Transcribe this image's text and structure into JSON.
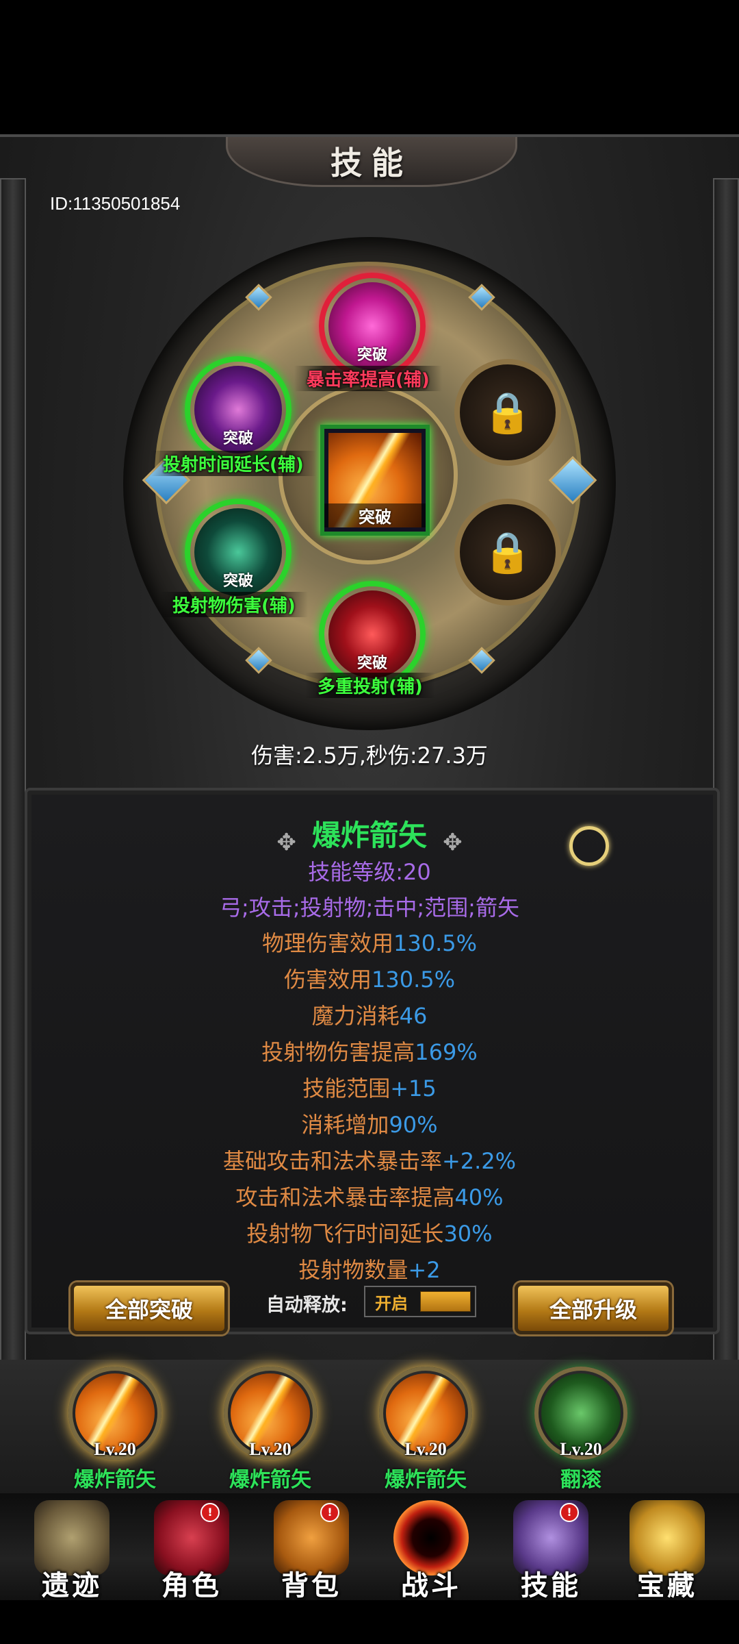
{
  "header": {
    "title": "技能",
    "user_id": "ID:11350501854"
  },
  "wheel": {
    "center_skill": {
      "badge": "突破",
      "icon": "explosive-arrow-icon"
    },
    "break_label": "突破",
    "support_skills": [
      {
        "name": "暴击率提高(辅)",
        "badge": "突破",
        "state": "red"
      },
      {
        "name": "投射时间延长(辅)",
        "badge": "突破",
        "state": "green"
      },
      {
        "name": "投射物伤害(辅)",
        "badge": "突破",
        "state": "green"
      },
      {
        "name": "多重投射(辅)",
        "badge": "突破",
        "state": "green"
      }
    ],
    "locked_slots": 2
  },
  "damage_line": "伤害:2.5万,秒伤:27.3万",
  "skill_info": {
    "name": "爆炸箭矢",
    "level_label": "技能等级:20",
    "tags": "弓;攻击;投射物;击中;范围;箭矢",
    "stats": [
      {
        "label": "物理伤害效用",
        "value": "130.5%"
      },
      {
        "label": "伤害效用",
        "value": "130.5%"
      },
      {
        "label": "魔力消耗",
        "value": "46"
      },
      {
        "label": "投射物伤害提高",
        "value": "169%"
      },
      {
        "label": "技能范围",
        "value": "+15"
      },
      {
        "label": "消耗增加",
        "value": "90%"
      },
      {
        "label": "基础攻击和法术暴击率",
        "value": "+2.2%"
      },
      {
        "label": "攻击和法术暴击率提高",
        "value": "40%"
      },
      {
        "label": "投射物飞行时间延长",
        "value": "30%"
      },
      {
        "label": "投射物数量",
        "value": "+2"
      }
    ]
  },
  "actions": {
    "break_all": "全部突破",
    "auto_release_label": "自动释放:",
    "auto_release_state": "开启",
    "upgrade_all": "全部升级"
  },
  "equipped": [
    {
      "level": "Lv.20",
      "name": "爆炸箭矢"
    },
    {
      "level": "Lv.20",
      "name": "爆炸箭矢"
    },
    {
      "level": "Lv.20",
      "name": "爆炸箭矢"
    },
    {
      "level": "Lv.20",
      "name": "翻滚"
    }
  ],
  "nav": [
    {
      "label": "遗迹",
      "icon": "relic-icon",
      "badge": ""
    },
    {
      "label": "角色",
      "icon": "character-icon",
      "badge": "!"
    },
    {
      "label": "背包",
      "icon": "backpack-icon",
      "badge": "!"
    },
    {
      "label": "战斗",
      "icon": "portal-icon",
      "badge": ""
    },
    {
      "label": "技能",
      "icon": "spellbook-icon",
      "badge": "!"
    },
    {
      "label": "宝藏",
      "icon": "treasure-icon",
      "badge": ""
    }
  ],
  "colors": {
    "green": "#2de25a",
    "red": "#ff3b5c",
    "purple": "#a86be8",
    "orange": "#e08a44",
    "blue": "#3b9ae6",
    "gold": "#f0b030"
  }
}
